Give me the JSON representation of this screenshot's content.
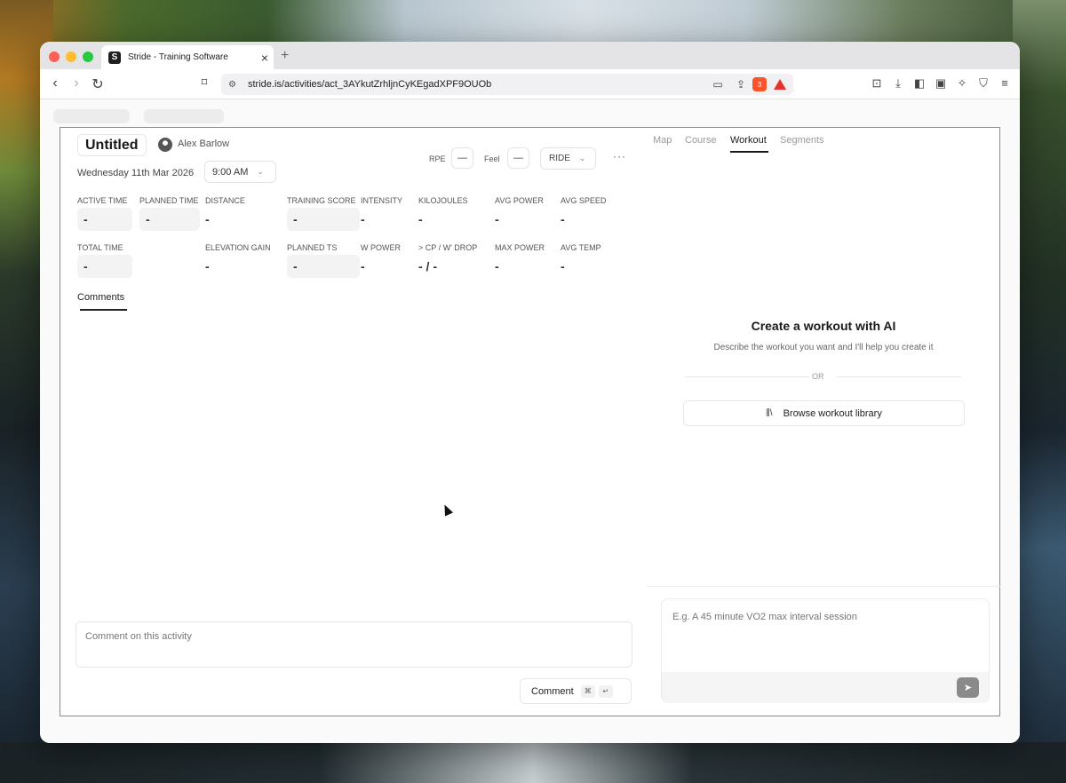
{
  "browser": {
    "tab_title": "Stride - Training Software",
    "tab_favicon": "S",
    "tab_close": "×",
    "new_tab": "+",
    "url": "stride.is/activities/act_3AYkutZrhljnCyKEgadXPF9OUOb",
    "brave_badge": "3"
  },
  "activity": {
    "title": "Untitled",
    "author": "Alex Barlow",
    "date": "Wednesday 11th Mar 2026",
    "time": "9:00 AM",
    "rpe_label": "RPE",
    "rpe_value": "—",
    "feel_label": "Feel",
    "feel_value": "—",
    "sport": "RIDE",
    "more": "···"
  },
  "metrics": {
    "row1": [
      {
        "label": "ACTIVE TIME",
        "value": "-"
      },
      {
        "label": "PLANNED TIME",
        "value": "-"
      },
      {
        "label": "DISTANCE",
        "value": "-"
      },
      {
        "label": "TRAINING SCORE",
        "value": "-"
      },
      {
        "label": "INTENSITY",
        "value": "-"
      },
      {
        "label": "KILOJOULES",
        "value": "-"
      },
      {
        "label": "AVG POWER",
        "value": "-"
      },
      {
        "label": "AVG SPEED",
        "value": "-"
      }
    ],
    "row2": [
      {
        "label": "TOTAL TIME",
        "value": "-"
      },
      {
        "label": "ELEVATION GAIN",
        "value": "-"
      },
      {
        "label": "PLANNED TS",
        "value": "-"
      },
      {
        "label": "W POWER",
        "value": "-"
      },
      {
        "label": "> CP / W' DROP",
        "value": "- / -"
      },
      {
        "label": "MAX POWER",
        "value": "-"
      },
      {
        "label": "AVG TEMP",
        "value": "-"
      }
    ]
  },
  "comments": {
    "tab_label": "Comments",
    "placeholder": "Comment on this activity",
    "button_label": "Comment",
    "kbd_cmd": "⌘",
    "kbd_enter": "↵"
  },
  "right_tabs": [
    "Map",
    "Course",
    "Workout",
    "Segments"
  ],
  "ai": {
    "title": "Create a workout with AI",
    "subtitle": "Describe the workout you want and I'll help you create it",
    "or": "OR",
    "browse_label": "Browse workout library",
    "chat_placeholder": "E.g. A 45 minute VO2 max interval session"
  },
  "colors": {
    "accent_dark": "#1a1a1a",
    "send_button": "#8a8a8a",
    "brave_orange": "#fb542b"
  }
}
